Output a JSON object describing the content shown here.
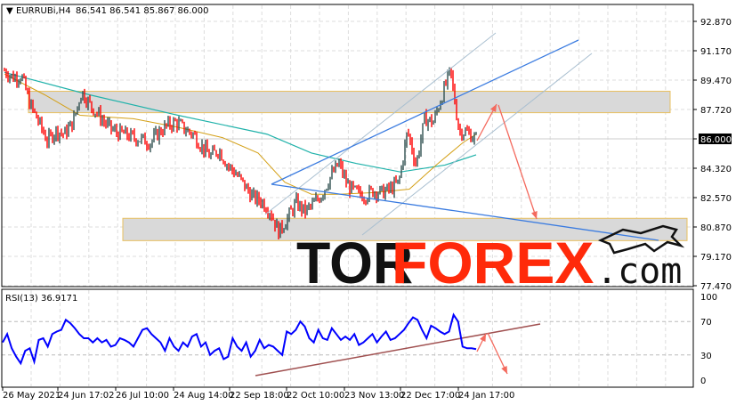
{
  "header": {
    "symbol": "EURRUBi,H4",
    "ohlc": "86.541 86.541 85.867 86.000"
  },
  "rsi_label": "RSI(13) 36.9171",
  "logo": {
    "part1": "TOR",
    "part2": "FOREX",
    "part3": ".com"
  },
  "colors": {
    "up": "#2f4f4f",
    "down": "#ff0000",
    "ma_fast": "#d4a017",
    "ma_slow": "#20b2aa",
    "rsi": "#0000ff",
    "trend": "#3a7be0",
    "channel": "#a9bfd0",
    "arrow": "#f46a5e",
    "logo_red": "#ff2a0a"
  },
  "chart_data": [
    {
      "type": "line",
      "title": "EURRUBi,H4",
      "price_ticks": [
        "92.870",
        "91.170",
        "89.470",
        "87.720",
        "86.000",
        "84.320",
        "82.570",
        "80.870",
        "79.170",
        "77.470"
      ],
      "current_price": "86.000",
      "ylim": [
        77.47,
        92.87
      ],
      "x_labels": [
        "26 May 2021",
        "24 Jun 17:02",
        "26 Jul 10:00",
        "24 Aug 14:00",
        "22 Sep 18:00",
        "22 Oct 10:00",
        "23 Nov 13:00",
        "22 Dec 17:00",
        "24 Jan 17:00"
      ],
      "close": [
        90.0,
        89.6,
        89.7,
        88.0,
        87.0,
        85.9,
        86.5,
        86.3,
        87.0,
        88.8,
        88.0,
        87.4,
        86.8,
        86.4,
        86.3,
        86.1,
        86.0,
        85.8,
        86.4,
        86.8,
        87.0,
        86.6,
        86.3,
        85.6,
        85.0,
        85.4,
        84.5,
        84.0,
        83.3,
        82.6,
        82.4,
        81.8,
        80.6,
        81.4,
        82.3,
        81.8,
        82.2,
        82.8,
        83.8,
        84.6,
        83.3,
        82.9,
        82.7,
        83.0,
        82.9,
        83.1,
        83.5,
        86.5,
        84.5,
        87.2,
        87.0,
        88.5,
        90.0,
        86.5,
        86.4,
        86.0
      ],
      "ma_fast": [
        89.8,
        88.6,
        87.4,
        87.2,
        86.7,
        86.1,
        85.2,
        83.5,
        82.8,
        82.8,
        82.9,
        83.1,
        84.5,
        85.8,
        86.3
      ],
      "ma_slow": [
        89.9,
        88.6,
        87.4,
        86.3,
        85.2,
        84.6,
        84.1,
        84.5,
        85.1
      ],
      "zones": [
        [
          87.55,
          88.8
        ],
        [
          80.1,
          81.4
        ]
      ]
    },
    {
      "type": "line",
      "title": "RSI(13)",
      "last_value": 36.9171,
      "y_ticks": [
        "100",
        "70",
        "30",
        "0"
      ],
      "ylim": [
        0,
        100
      ],
      "values": [
        45,
        55,
        38,
        28,
        20,
        35,
        38,
        22,
        48,
        50,
        40,
        55,
        58,
        60,
        72,
        68,
        62,
        55,
        50,
        50,
        45,
        50,
        45,
        48,
        40,
        42,
        50,
        48,
        45,
        40,
        50,
        60,
        62,
        55,
        50,
        45,
        35,
        50,
        40,
        35,
        45,
        40,
        52,
        55,
        40,
        45,
        30,
        35,
        38,
        25,
        28,
        50,
        40,
        35,
        45,
        28,
        35,
        48,
        38,
        42,
        40,
        35,
        30,
        58,
        55,
        60,
        70,
        64,
        50,
        45,
        60,
        50,
        48,
        62,
        55,
        48,
        52,
        48,
        55,
        42,
        45,
        50,
        55,
        45,
        52,
        58,
        48,
        50,
        55,
        60,
        68,
        75,
        72,
        60,
        50,
        65,
        62,
        58,
        55,
        58,
        78,
        70,
        40,
        38,
        38,
        37
      ]
    }
  ]
}
